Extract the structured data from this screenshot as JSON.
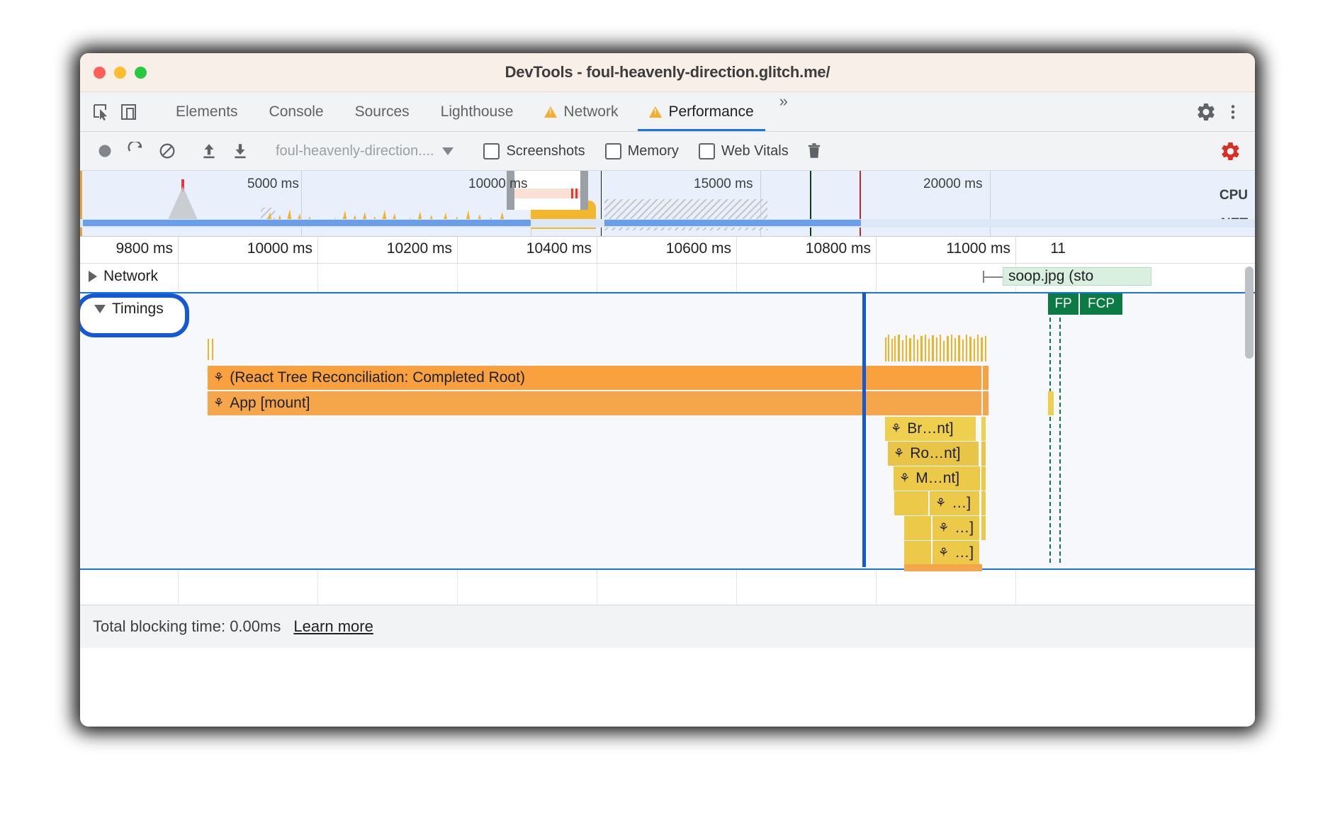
{
  "window": {
    "title": "DevTools - foul-heavenly-direction.glitch.me/",
    "traffic_lights": [
      "close",
      "minimize",
      "maximize"
    ]
  },
  "tabstrip": {
    "left_icons": [
      {
        "name": "inspect-element-icon",
        "label": "inspect"
      },
      {
        "name": "device-toolbar-icon",
        "label": "device"
      }
    ],
    "tabs": [
      {
        "label": "Elements",
        "warn": false,
        "active": false
      },
      {
        "label": "Console",
        "warn": false,
        "active": false
      },
      {
        "label": "Sources",
        "warn": false,
        "active": false
      },
      {
        "label": "Lighthouse",
        "warn": false,
        "active": false
      },
      {
        "label": "Network",
        "warn": true,
        "active": false
      },
      {
        "label": "Performance",
        "warn": true,
        "active": true
      }
    ],
    "overflow_label": "»",
    "right_icons": [
      {
        "name": "gear-icon"
      },
      {
        "name": "kebab-menu-icon"
      }
    ]
  },
  "perf_toolbar": {
    "record_label": "record",
    "reload_label": "reload-and-record",
    "clear_label": "clear",
    "upload_label": "load-profile",
    "download_label": "save-profile",
    "page_selector": "foul-heavenly-direction....",
    "checkboxes": [
      {
        "label": "Screenshots",
        "checked": false
      },
      {
        "label": "Memory",
        "checked": false
      },
      {
        "label": "Web Vitals",
        "checked": false
      }
    ],
    "trash_label": "collect-garbage",
    "settings_label": "capture-settings",
    "settings_color": "#d93025"
  },
  "overview": {
    "tick_labels": [
      "5000 ms",
      "10000 ms",
      "15000 ms",
      "20000 ms"
    ],
    "side_labels": [
      "CPU",
      "NET"
    ]
  },
  "ruler": {
    "labels": [
      "9800 ms",
      "10000 ms",
      "10200 ms",
      "10400 ms",
      "10600 ms",
      "10800 ms",
      "11000 ms",
      "11"
    ]
  },
  "tracks": {
    "network": {
      "label": "Network",
      "expanded": false
    },
    "timings": {
      "label": "Timings",
      "expanded": true,
      "highlighted": true
    }
  },
  "network_items": [
    {
      "label": "soop.jpg (sto"
    }
  ],
  "markers": [
    {
      "label": "FP"
    },
    {
      "label": "FCP"
    }
  ],
  "flame_bars": [
    {
      "label": "(React Tree Reconciliation: Completed Root)",
      "depth": 0,
      "color": "#f8a13e"
    },
    {
      "label": "App [mount]",
      "depth": 1,
      "color": "#f6a64a"
    },
    {
      "label": "Br…nt]",
      "depth": 2,
      "color": "#efcf4e"
    },
    {
      "label": "Ro…nt]",
      "depth": 3,
      "color": "#e8c547"
    },
    {
      "label": "M…nt]",
      "depth": 4,
      "color": "#edc94a"
    },
    {
      "label": "…]",
      "depth": 5,
      "color": "#edc94a"
    },
    {
      "label": "…]",
      "depth": 6,
      "color": "#edc94a"
    },
    {
      "label": "…]",
      "depth": 7,
      "color": "#edc94a"
    }
  ],
  "status": {
    "total_blocking_time": "Total blocking time: 0.00ms",
    "learn_more": "Learn more"
  },
  "colors": {
    "accent": "#1a73e8",
    "highlight_ring": "#1558d6",
    "warning": "#f5ad2d",
    "record_red": "#d93025",
    "orange_bar": "#f8a13e",
    "yellow_bar": "#efcf4e",
    "marker_green": "#0b7b43"
  }
}
